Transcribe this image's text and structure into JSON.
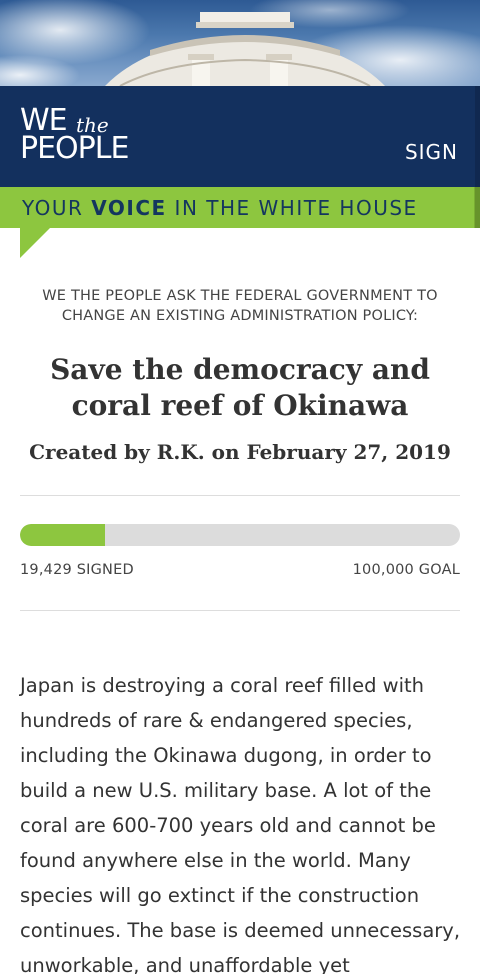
{
  "header": {
    "logo_we": "WE",
    "logo_the": "the",
    "logo_people": "PEOPLE",
    "sign_label": "SIGN"
  },
  "tagline": {
    "pre": "YOUR ",
    "emphasis": "VOICE",
    "post": " IN THE WHITE HOUSE"
  },
  "petition": {
    "ask": "WE THE PEOPLE ASK THE FEDERAL GOVERNMENT TO CHANGE AN EXISTING ADMINISTRATION POLICY:",
    "title": "Save the democracy and coral reef of Okinawa",
    "created": "Created by R.K. on February 27, 2019",
    "signed_label": "19,429 SIGNED",
    "goal_label": "100,000 GOAL",
    "progress_fraction": 0.19429,
    "body": "Japan is destroying a coral reef filled with hundreds of rare & endangered species, including the Okinawa dugong, in order to build a new U.S. military base. A lot of the coral are 600-700 years old and cannot be found anywhere else in the world. Many species will go extinct if the construction continues. The base is deemed unnecessary, unworkable, and unaffordable yet"
  },
  "colors": {
    "brand_navy": "#13305e",
    "brand_green": "#8dc63f",
    "track_gray": "#dcdcdc"
  }
}
